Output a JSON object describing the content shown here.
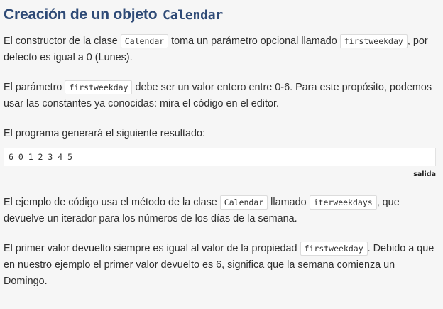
{
  "heading": {
    "text": "Creación de un objeto ",
    "code": "Calendar"
  },
  "p1": {
    "t1": "El constructor de la clase ",
    "c1": "Calendar",
    "t2": " toma un parámetro opcional llamado ",
    "c2": "firstweekday",
    "t3": ", por defecto es igual a 0 (Lunes)."
  },
  "p2": {
    "t1": "El parámetro ",
    "c1": "firstweekday",
    "t2": " debe ser un valor entero entre 0-6. Para este propósito, podemos usar las constantes ya conocidas: mira el código en el editor."
  },
  "p3": {
    "t1": "El programa generará el siguiente resultado:"
  },
  "output": {
    "text": "6 0 1 2 3 4 5",
    "caption": "salida"
  },
  "p4": {
    "t1": "El ejemplo de código usa el método de la clase ",
    "c1": "Calendar",
    "t2": " llamado ",
    "c2": "iterweekdays",
    "t3": ", que devuelve un iterador para los números de los días de la semana."
  },
  "p5": {
    "t1": "El primer valor devuelto siempre es igual al valor de la propiedad ",
    "c1": "firstweekday",
    "t2": ". Debido a que en nuestro ejemplo el primer valor devuelto es 6, significa que la semana comienza un Domingo."
  }
}
